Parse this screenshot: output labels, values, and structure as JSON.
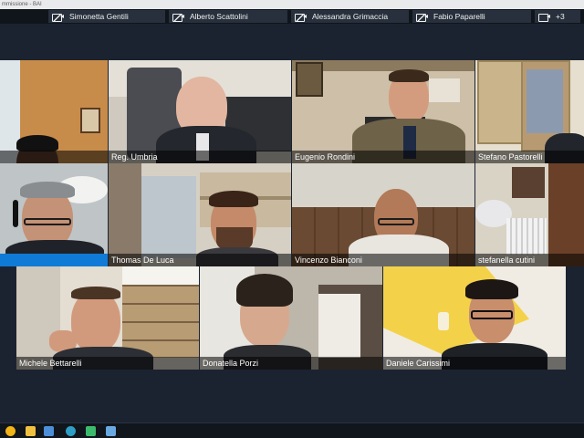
{
  "window": {
    "title": "mmissione - BAI"
  },
  "participant_strip": [
    {
      "name": "Simonetta Gentili",
      "camera": "off"
    },
    {
      "name": "Alberto Scattolini",
      "camera": "off"
    },
    {
      "name": "Alessandra Grimaccia",
      "camera": "off"
    },
    {
      "name": "Fabio Paparelli",
      "camera": "off"
    },
    {
      "name": "+3",
      "camera": "on"
    }
  ],
  "tiles": [
    {
      "name": "",
      "active": false
    },
    {
      "name": "Reg. Umbria",
      "active": false
    },
    {
      "name": "Eugenio Rondini",
      "active": false
    },
    {
      "name": "Stefano Pastorelli",
      "active": false
    },
    {
      "name": "",
      "active": true
    },
    {
      "name": "Thomas De Luca",
      "active": false
    },
    {
      "name": "Vincenzo Bianconi",
      "active": false
    },
    {
      "name": "stefanella cutini",
      "active": false
    },
    {
      "name": "Michele Bettarelli",
      "active": false
    },
    {
      "name": "Donatella Porzi",
      "active": false
    },
    {
      "name": "Daniele Carissimi",
      "active": false
    }
  ],
  "icons": [
    "camera-off-icon",
    "camera-icon",
    "windows-start-icon",
    "file-explorer-icon",
    "teams-icon",
    "chrome-icon",
    "app-icon"
  ],
  "colors": {
    "background": "#1b2330",
    "active_speaker": "#0f7bd6",
    "strip": "#10151c"
  }
}
